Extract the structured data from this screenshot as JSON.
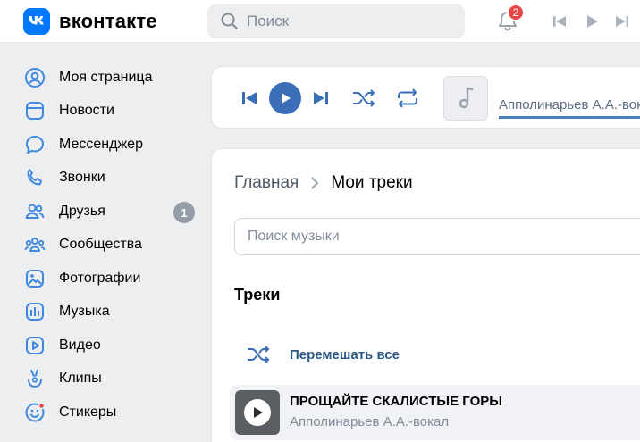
{
  "header": {
    "logo_text": "вконтакте",
    "search": {
      "placeholder": "Поиск",
      "value": ""
    },
    "notifications": {
      "count": "2"
    }
  },
  "sidebar": {
    "items": [
      {
        "label": "Моя страница",
        "icon": "user-circle-icon"
      },
      {
        "label": "Новости",
        "icon": "news-icon"
      },
      {
        "label": "Мессенджер",
        "icon": "message-icon"
      },
      {
        "label": "Звонки",
        "icon": "phone-icon"
      },
      {
        "label": "Друзья",
        "icon": "friends-icon",
        "badge": "1"
      },
      {
        "label": "Сообщества",
        "icon": "communities-icon"
      },
      {
        "label": "Фотографии",
        "icon": "photo-icon"
      },
      {
        "label": "Музыка",
        "icon": "music-icon"
      },
      {
        "label": "Видео",
        "icon": "video-icon"
      },
      {
        "label": "Клипы",
        "icon": "clips-icon"
      },
      {
        "label": "Стикеры",
        "icon": "stickers-icon"
      }
    ]
  },
  "player": {
    "now_playing_artist": "Апполинарьев А.А.-вокал"
  },
  "content": {
    "breadcrumb": {
      "home": "Главная",
      "current": "Мои треки"
    },
    "music_search": {
      "placeholder": "Поиск музыки",
      "value": ""
    },
    "section_title": "Треки",
    "shuffle_label": "Перемешать все",
    "tracks": [
      {
        "title": "ПРОЩАЙТЕ СКАЛИСТЫЕ ГОРЫ",
        "artist": "Апполинарьев А.А.-вокал"
      }
    ]
  },
  "colors": {
    "accent": "#0077ff",
    "link": "#2a5885",
    "play_button": "#3a6fb8",
    "badge_red": "#e64646"
  }
}
